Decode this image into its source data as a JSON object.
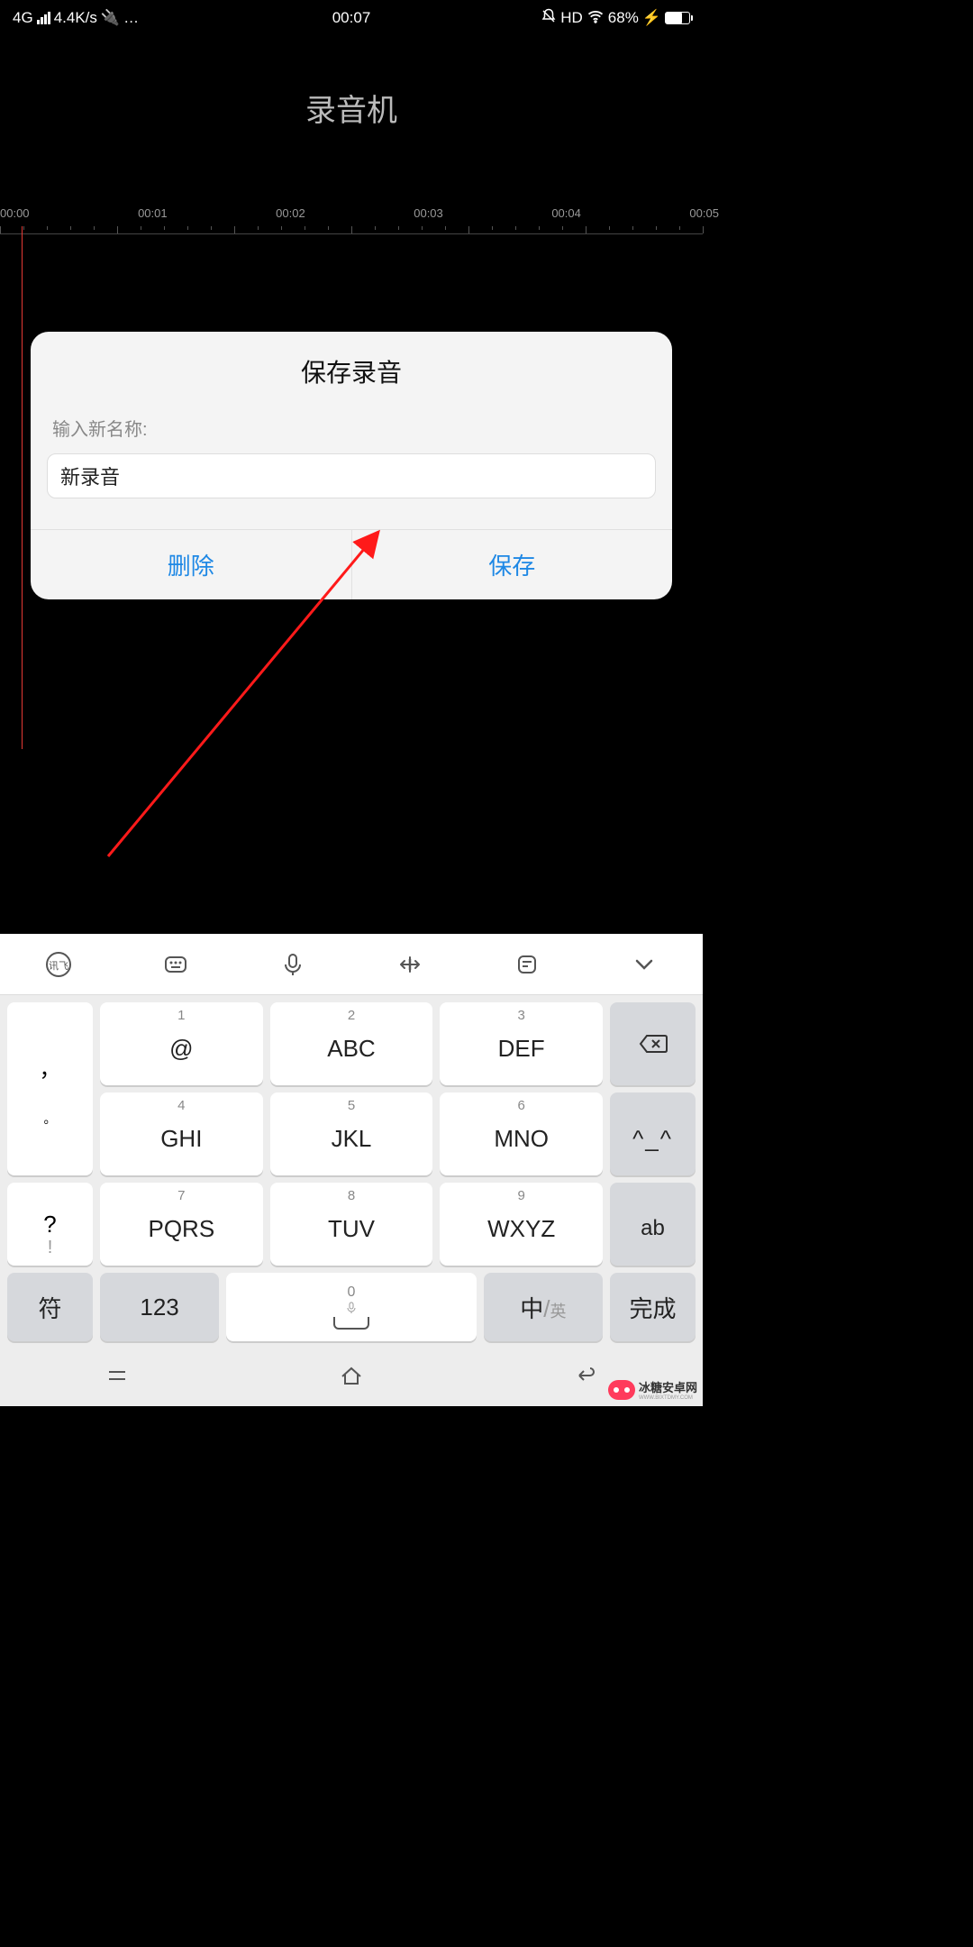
{
  "status": {
    "network": "4G",
    "speed": "4.4K/s",
    "usb": "⋔",
    "dots": "…",
    "time": "00:07",
    "dnd": "🔕",
    "hd": "HD",
    "battery_pct": "68%",
    "charging": "⚡"
  },
  "app": {
    "title": "录音机"
  },
  "timeline": {
    "labels": [
      "00:00",
      "00:01",
      "00:02",
      "00:03",
      "00:04",
      "00:05"
    ]
  },
  "dialog": {
    "title": "保存录音",
    "prompt": "输入新名称:",
    "value": "新录音",
    "delete": "删除",
    "save": "保存"
  },
  "keyboard": {
    "side_left": [
      "，",
      "。",
      "?",
      "!"
    ],
    "t9": [
      {
        "n": "1",
        "m": "@"
      },
      {
        "n": "2",
        "m": "ABC"
      },
      {
        "n": "3",
        "m": "DEF"
      },
      {
        "n": "4",
        "m": "GHI"
      },
      {
        "n": "5",
        "m": "JKL"
      },
      {
        "n": "6",
        "m": "MNO"
      },
      {
        "n": "7",
        "m": "PQRS"
      },
      {
        "n": "8",
        "m": "TUV"
      },
      {
        "n": "9",
        "m": "WXYZ"
      }
    ],
    "side_right_emoji": "^_^",
    "side_right_ab": "ab",
    "bottom": {
      "sym": "符",
      "num": "123",
      "zero": "0",
      "lang_cn": "中",
      "lang_sep": "/",
      "lang_en": "英",
      "done": "完成"
    }
  },
  "watermark": {
    "text": "冰糖安卓网",
    "sub": "WWW.BIXTDMY.COM"
  }
}
